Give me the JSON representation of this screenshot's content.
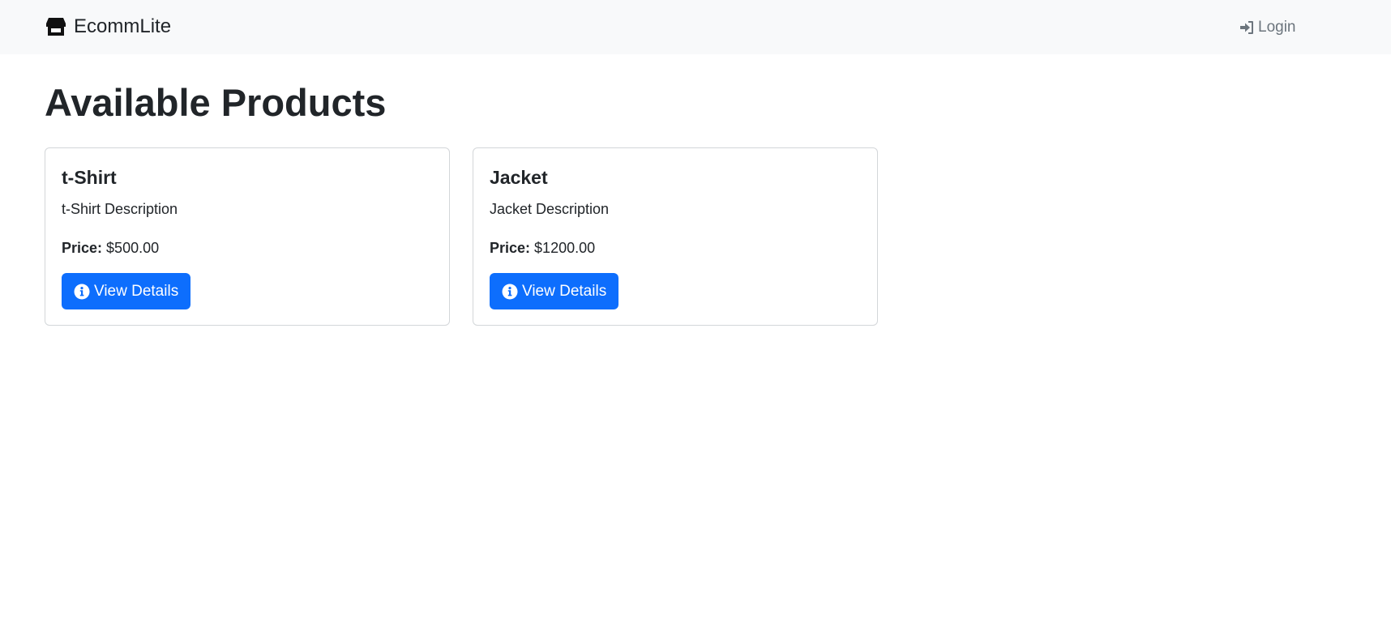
{
  "navbar": {
    "brand": {
      "icon": "store-icon",
      "label": "EcommLite"
    },
    "login": {
      "icon": "sign-in-icon",
      "label": "Login"
    }
  },
  "main": {
    "title": "Available Products",
    "products": [
      {
        "name": "t-Shirt",
        "description": "t-Shirt Description",
        "price_label": "Price:",
        "price": "$500.00",
        "button": {
          "icon": "info-circle-icon",
          "label": "View Details"
        }
      },
      {
        "name": "Jacket",
        "description": "Jacket Description",
        "price_label": "Price:",
        "price": "$1200.00",
        "button": {
          "icon": "info-circle-icon",
          "label": "View Details"
        }
      }
    ]
  },
  "colors": {
    "navbar_bg": "#f8f9fa",
    "primary": "#0d6efd",
    "text": "#212529",
    "muted": "#6c757d",
    "card_border": "#d3d6d9"
  }
}
